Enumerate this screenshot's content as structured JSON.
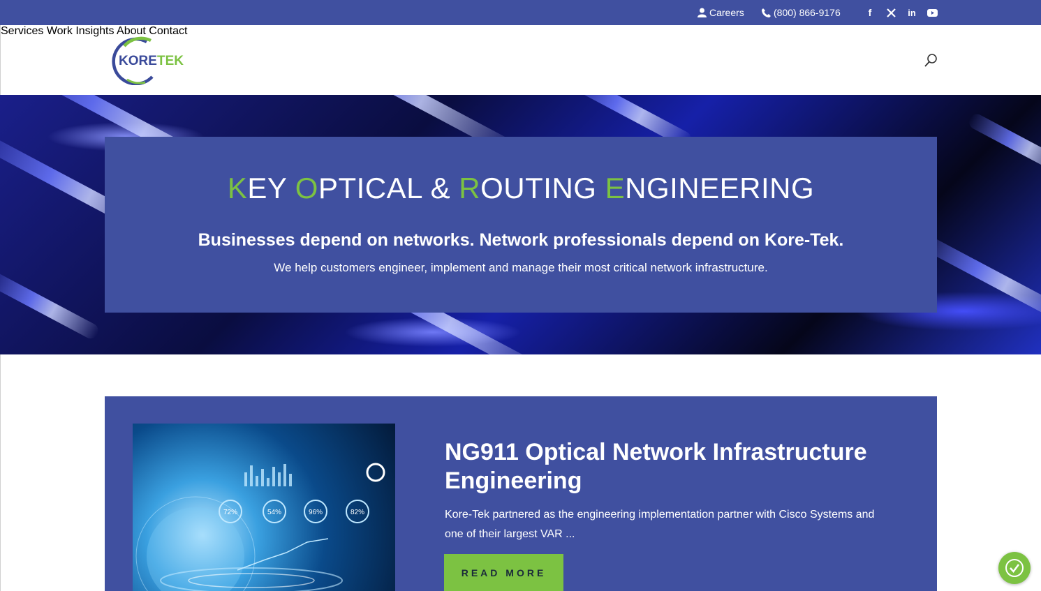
{
  "topbar": {
    "careers_label": "Careers",
    "phone_label": "(800) 866-9176",
    "social": [
      "facebook-icon",
      "x-icon",
      "linkedin-icon",
      "youtube-icon"
    ],
    "background_color": "#4050a0"
  },
  "header": {
    "logo_text_left": "KORE",
    "logo_text_right": "TEK",
    "nav": [
      "Services",
      "Work",
      "Insights",
      "About",
      "Contact"
    ]
  },
  "hero": {
    "title_parts": [
      {
        "accent": "K",
        "rest": "EY "
      },
      {
        "accent": "O",
        "rest": "PTICAL & "
      },
      {
        "accent": "R",
        "rest": "OUTING "
      },
      {
        "accent": "E",
        "rest": "NGINEERING"
      }
    ],
    "subtitle": "Businesses depend on networks. Network professionals depend on Kore-Tek.",
    "text": "We help customers engineer, implement and manage their most critical network infrastructure."
  },
  "card": {
    "title": "NG911 Optical Network Infrastructure Engineering",
    "text": "Kore-Tek partnered as the engineering implementation partner with Cisco Systems and one of their largest VAR ...",
    "button_label": "READ MORE",
    "image_labels": [
      "72%",
      "54%",
      "96%",
      "82%"
    ]
  },
  "colors": {
    "brand_blue": "#4050a0",
    "accent_green": "#7cc242"
  }
}
